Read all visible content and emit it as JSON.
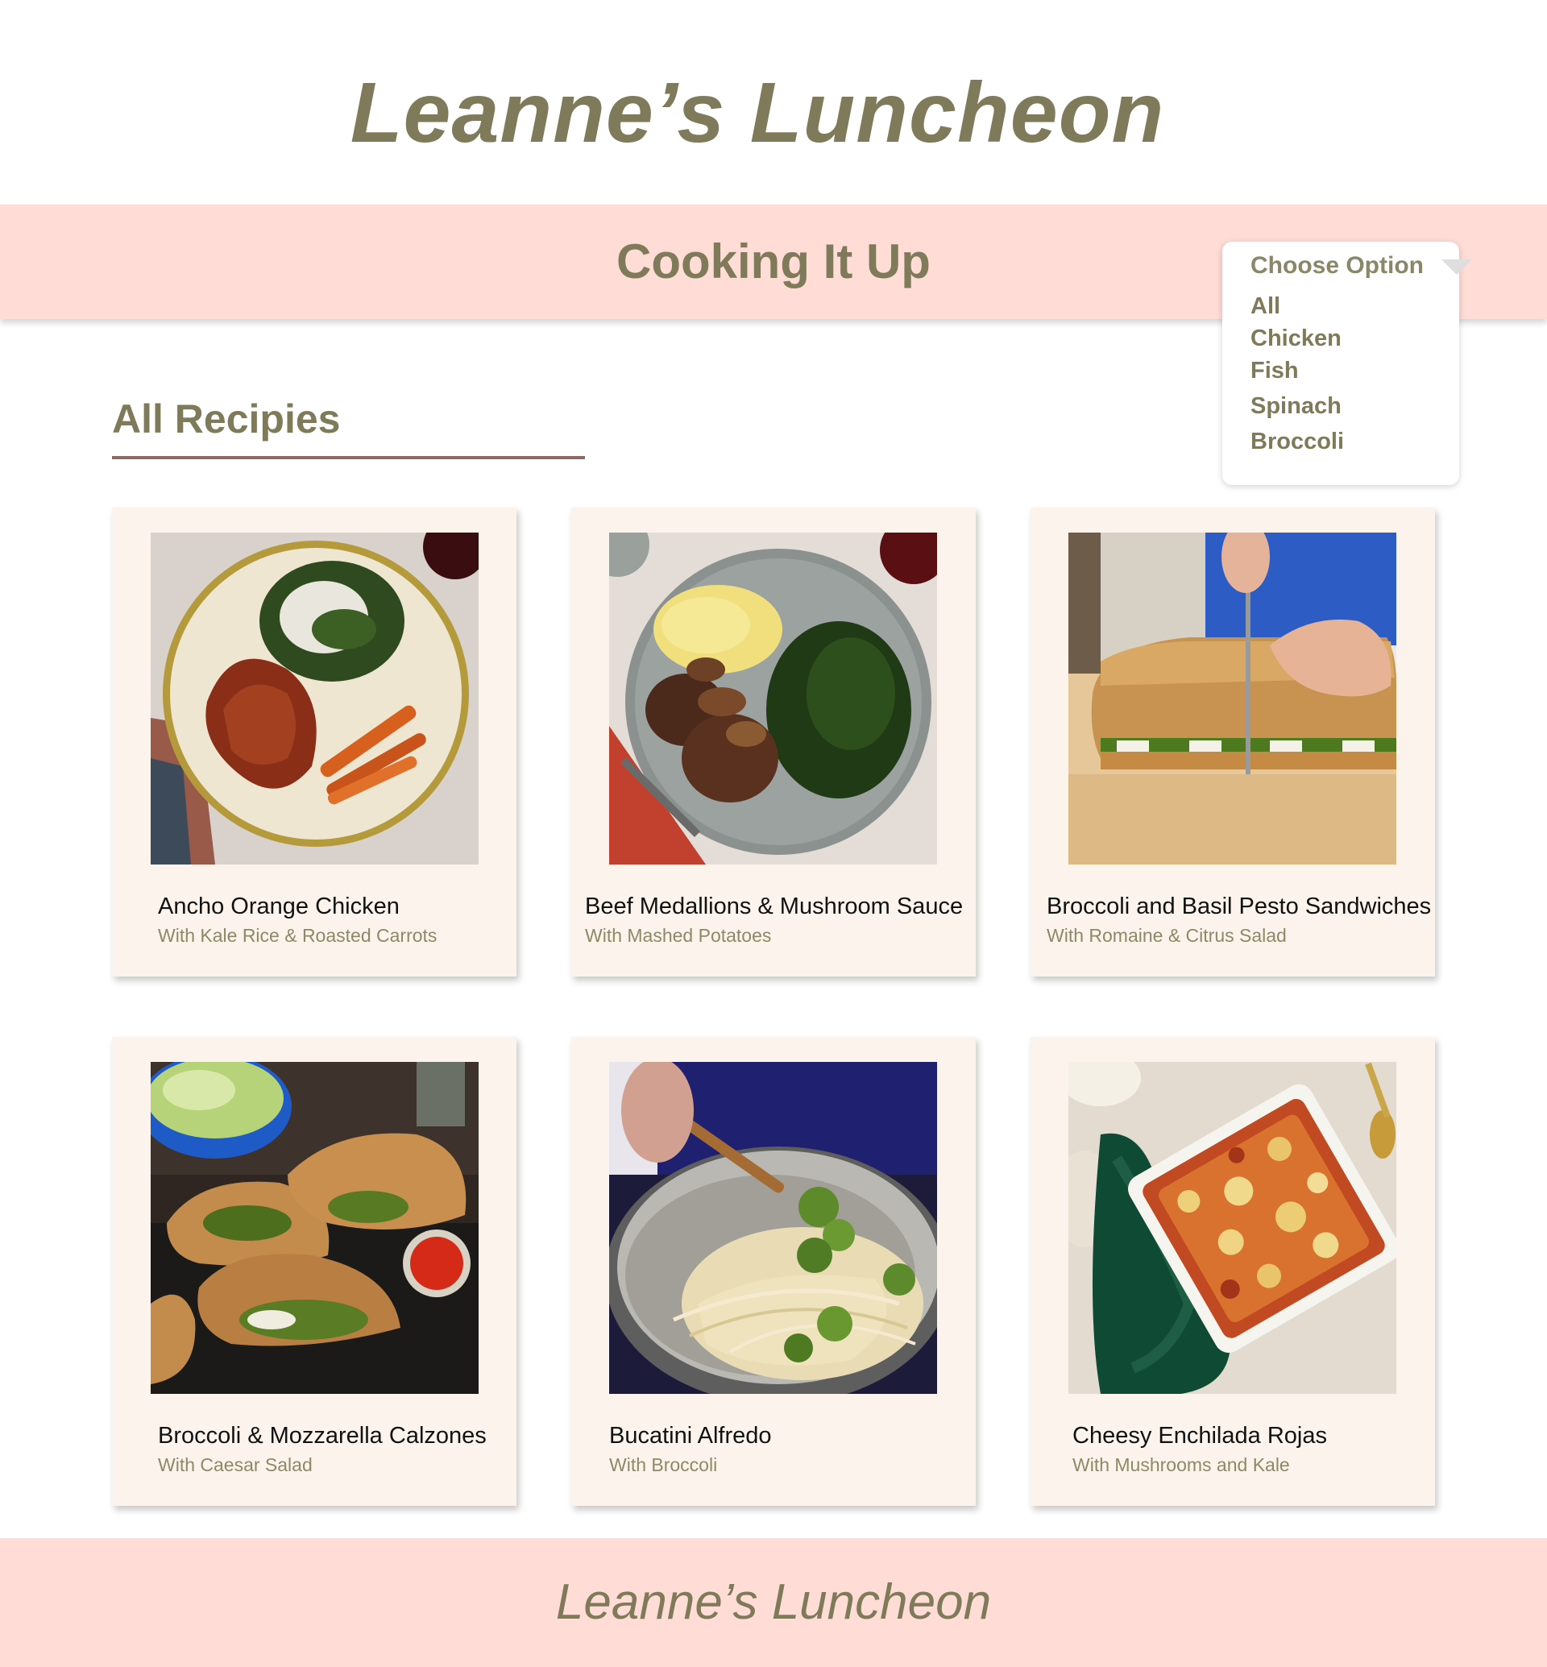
{
  "site": {
    "title": "Leanne’s Luncheon",
    "banner_title": "Cooking It Up",
    "footer_title": "Leanne’s Luncheon"
  },
  "filter": {
    "label": "Choose Option",
    "options": [
      "All",
      "Chicken",
      "Fish",
      "Spinach",
      "Broccoli"
    ]
  },
  "section": {
    "heading": "All Recipies"
  },
  "recipes": [
    {
      "title": "Ancho Orange Chicken",
      "subtitle": "With Kale Rice & Roasted Carrots"
    },
    {
      "title": "Beef Medallions & Mushroom Sauce",
      "subtitle": "With Mashed Potatoes"
    },
    {
      "title": "Broccoli and Basil Pesto Sandwiches",
      "subtitle": "With Romaine & Citrus Salad"
    },
    {
      "title": "Broccoli & Mozzarella Calzones",
      "subtitle": "With Caesar Salad"
    },
    {
      "title": "Bucatini Alfredo",
      "subtitle": "With Broccoli"
    },
    {
      "title": "Cheesy Enchilada Rojas",
      "subtitle": "With Mushrooms and Kale"
    }
  ],
  "colors": {
    "accent_text": "#7e7a5a",
    "banner_bg": "#ffdcd5",
    "card_bg": "#fcf4ec",
    "rule": "#8b6a66"
  }
}
